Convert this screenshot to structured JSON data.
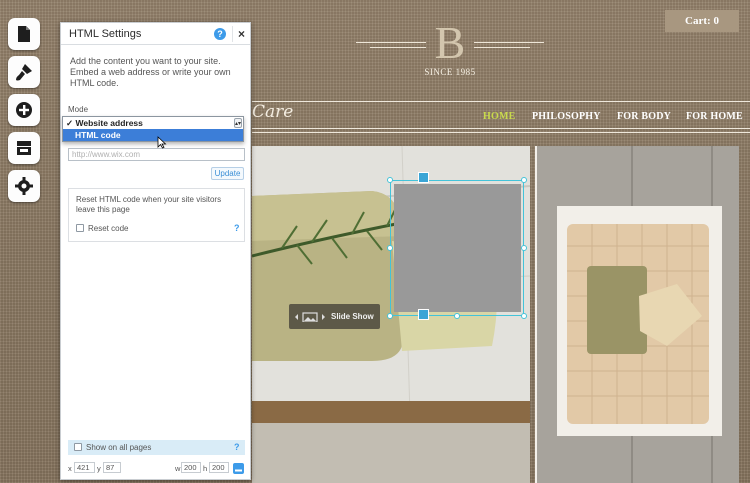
{
  "toolbar": {
    "items": [
      {
        "icon": "page-icon"
      },
      {
        "icon": "paintbrush-icon"
      },
      {
        "icon": "add-icon"
      },
      {
        "icon": "store-icon"
      },
      {
        "icon": "gear-icon"
      }
    ]
  },
  "site": {
    "logo_letter": "B",
    "logo_tagline": "SINCE 1985",
    "cart_label": "Cart: 0",
    "brand_fragment": "Care",
    "nav": [
      {
        "label": "HOME",
        "active": true
      },
      {
        "label": "PHILOSOPHY",
        "active": false
      },
      {
        "label": "FOR BODY",
        "active": false
      },
      {
        "label": "FOR HOME",
        "active": false
      }
    ],
    "slideshow_label": "Slide Show"
  },
  "panel": {
    "title": "HTML Settings",
    "help_glyph": "?",
    "close_glyph": "×",
    "description": "Add the content you want to your site. Embed a web address or write your own HTML code.",
    "mode_label": "Mode",
    "mode_options": [
      {
        "label": "✓ Website address",
        "selected": false
      },
      {
        "label": "HTML code",
        "selected": true
      }
    ],
    "url_placeholder": "http://www.wix.com",
    "update_label": "Update",
    "reset_text": "Reset HTML code when your site visitors leave this page",
    "reset_checkbox_label": "Reset code",
    "show_on_all_label": "Show on all pages",
    "x_label": "x",
    "x_value": "421",
    "y_label": "y",
    "y_value": "87",
    "w_label": "w",
    "w_value": "200",
    "h_label": "h",
    "h_value": "200"
  },
  "colors": {
    "nav_active": "#c9da4d",
    "accent_blue": "#3d9be9",
    "selection_cyan": "#43c3d9",
    "component_gray": "#999999"
  }
}
